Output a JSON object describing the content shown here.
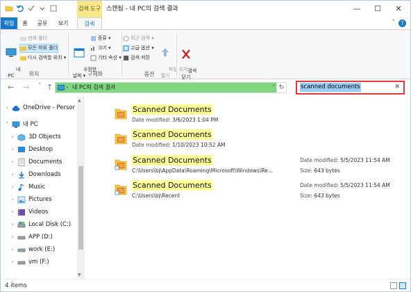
{
  "title_bar": {
    "context_tab": "검색 도구",
    "title": "스캔됨 - 내 PC의 검색 결과",
    "minimize": "—",
    "maximize": "☐",
    "close": "✕"
  },
  "ribbon_tabs": {
    "file": "파일",
    "home": "홈",
    "share": "공유",
    "view": "보기",
    "search": "검색"
  },
  "ribbon": {
    "location": {
      "this_pc": "내\nPC",
      "current_folder": "현재 폴더",
      "all_subfolders": "모든 하위 폴더",
      "search_again": "다시 검색할 위치 ▾",
      "label": "위치"
    },
    "refine": {
      "date_modified": "수정한\n날짜 ▾",
      "kind": "종류 ▾",
      "size": "크기 ▾",
      "other_props": "기타 속성 ▾",
      "label": "구체화"
    },
    "options": {
      "recent": "최근 검색 ▾",
      "advanced": "고급 옵션 ▾",
      "save_search": "검색 저장",
      "open_location": "파일 위치\n열기",
      "label": "옵션"
    },
    "close": {
      "label": "검색\n닫기"
    }
  },
  "nav": {
    "back": "←",
    "forward": "→",
    "recent": "˅",
    "up": "↑",
    "address": "내 PC의 검색 결과",
    "address_chevron": "›",
    "address_dropdown": "˅",
    "refresh": "↻",
    "search_value": "scanned documents",
    "search_clear": "✕"
  },
  "nav_pane": [
    {
      "label": "OneDrive - Persor",
      "icon": "cloud-icon",
      "expander": "›"
    },
    {
      "label": "내 PC",
      "icon": "pc-icon",
      "expander": "˅"
    },
    {
      "label": "3D Objects",
      "icon": "cube-icon",
      "expander": "›"
    },
    {
      "label": "Desktop",
      "icon": "desktop-icon",
      "expander": "›"
    },
    {
      "label": "Documents",
      "icon": "documents-icon",
      "expander": "›"
    },
    {
      "label": "Downloads",
      "icon": "downloads-icon",
      "expander": "›"
    },
    {
      "label": "Music",
      "icon": "music-icon",
      "expander": "›"
    },
    {
      "label": "Pictures",
      "icon": "pictures-icon",
      "expander": "›"
    },
    {
      "label": "Videos",
      "icon": "videos-icon",
      "expander": "›"
    },
    {
      "label": "Local Disk (C:)",
      "icon": "disk-icon",
      "expander": "›"
    },
    {
      "label": "APP (D:)",
      "icon": "drive-icon",
      "expander": "›"
    },
    {
      "label": "work (E:)",
      "icon": "drive-icon",
      "expander": "›"
    },
    {
      "label": "vm (F:)",
      "icon": "drive-icon",
      "expander": "›"
    }
  ],
  "results": [
    {
      "name": "Scanned Documents",
      "sub_label": "Date modified:",
      "sub_value": "3/6/2023 1:04 PM",
      "right_date_label": "",
      "right_date": "",
      "right_size_label": "",
      "right_size": ""
    },
    {
      "name": "Scanned Documents",
      "sub_label": "Date modified:",
      "sub_value": "1/10/2023 10:52 AM",
      "right_date_label": "",
      "right_date": "",
      "right_size_label": "",
      "right_size": ""
    },
    {
      "name": "Scanned Documents",
      "sub_label": "",
      "sub_value": "C:\\Users\\bj\\AppData\\Roaming\\Microsoft\\Windows\\Re...",
      "right_date_label": "Date modified:",
      "right_date": "5/5/2023 11:54 AM",
      "right_size_label": "Size:",
      "right_size": "643 bytes"
    },
    {
      "name": "Scanned Documents",
      "sub_label": "",
      "sub_value": "C:\\Users\\bj\\Recent",
      "right_date_label": "Date modified:",
      "right_date": "5/5/2023 11:54 AM",
      "right_size_label": "Size:",
      "right_size": "643 bytes"
    }
  ],
  "status": {
    "count": "4 items"
  },
  "colors": {
    "accent": "#1979ca",
    "highlight_red": "#e03a3a",
    "address_green": "#7ed67e",
    "result_yellow": "#ffff99",
    "search_selection": "#9ccdf5"
  }
}
